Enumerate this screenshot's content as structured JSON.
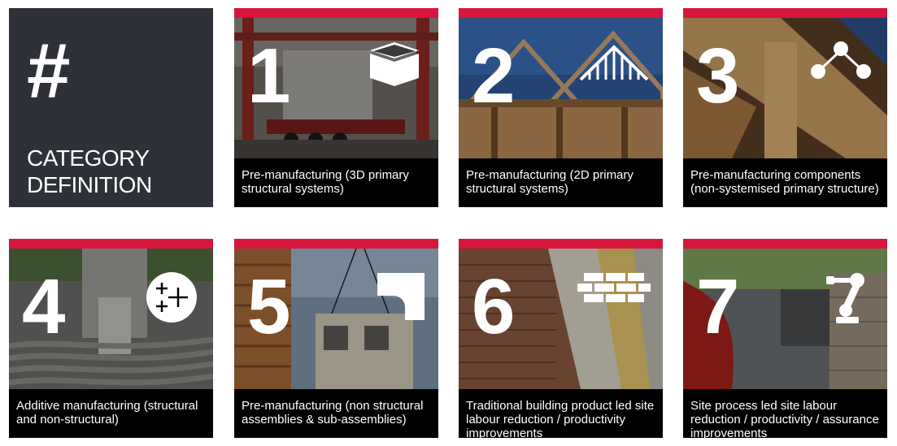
{
  "header": {
    "symbol": "#",
    "title": "CATEGORY DEFINITION"
  },
  "colors": {
    "accent": "#d6163c",
    "header_bg": "#2e3238",
    "caption_bg": "#000000"
  },
  "categories": [
    {
      "number": "1",
      "icon": "cube-icon",
      "caption": "Pre-manufacturing (3D primary structural systems)"
    },
    {
      "number": "2",
      "icon": "roof-truss-icon",
      "caption": "Pre-manufacturing (2D primary structural systems)"
    },
    {
      "number": "3",
      "icon": "node-connection-icon",
      "caption": "Pre-manufacturing components (non-systemised primary structure)"
    },
    {
      "number": "4",
      "icon": "additive-sparkle-icon",
      "caption": "Additive manufacturing (structural and non-structural)"
    },
    {
      "number": "5",
      "icon": "assembly-corner-icon",
      "caption": "Pre-manufacturing (non structural assemblies & sub-assemblies)"
    },
    {
      "number": "6",
      "icon": "brick-wall-icon",
      "caption": "Traditional building product led site labour reduction / productivity improvements"
    },
    {
      "number": "7",
      "icon": "robot-arm-icon",
      "caption": "Site process led site labour reduction / productivity / assurance improvements"
    }
  ]
}
